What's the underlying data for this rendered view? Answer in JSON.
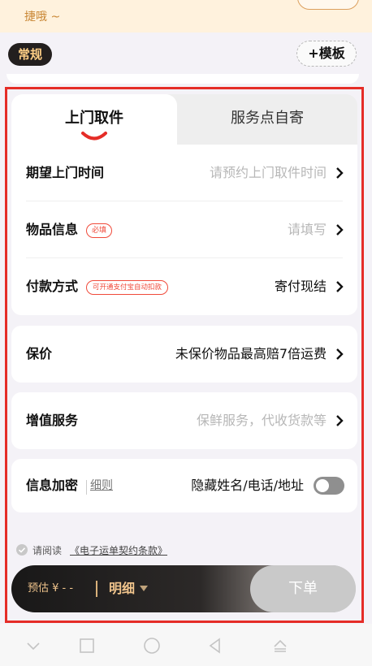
{
  "banner": {
    "text": "捷哦 ~"
  },
  "header": {
    "general_tag": "常规",
    "template_button": "模板"
  },
  "tabs": [
    {
      "label": "上门取件",
      "active": true
    },
    {
      "label": "服务点自寄",
      "active": false
    }
  ],
  "form": {
    "pickup_time": {
      "label": "期望上门时间",
      "value": "请预约上门取件时间"
    },
    "item_info": {
      "label": "物品信息",
      "badge": "必填",
      "value": "请填写"
    },
    "payment": {
      "label": "付款方式",
      "badge": "可开通支付宝自动扣款",
      "value": "寄付现结"
    }
  },
  "insurance": {
    "label": "保价",
    "value": "未保价物品最高赔7倍运费"
  },
  "value_added": {
    "label": "增值服务",
    "value": "保鲜服务，代收货款等"
  },
  "encryption": {
    "label": "信息加密",
    "rules_link": "细则",
    "value": "隐藏姓名/电话/地址",
    "toggle_on": false
  },
  "agreement": {
    "prefix": "请阅读",
    "link": "《电子运单契约条款》"
  },
  "bottom_bar": {
    "estimate": "预估 ¥ - -",
    "detail": "明细",
    "submit": "下单"
  },
  "colors": {
    "accent_red": "#e52d27",
    "gold": "#f0c48c",
    "dark": "#231f1e"
  },
  "icons": [
    "chevron-right-icon",
    "check-circle-icon",
    "caret-down-icon",
    "plus-icon",
    "nav-down-icon",
    "nav-home-icon",
    "nav-circle-icon",
    "nav-back-icon",
    "nav-keyboard-icon"
  ]
}
